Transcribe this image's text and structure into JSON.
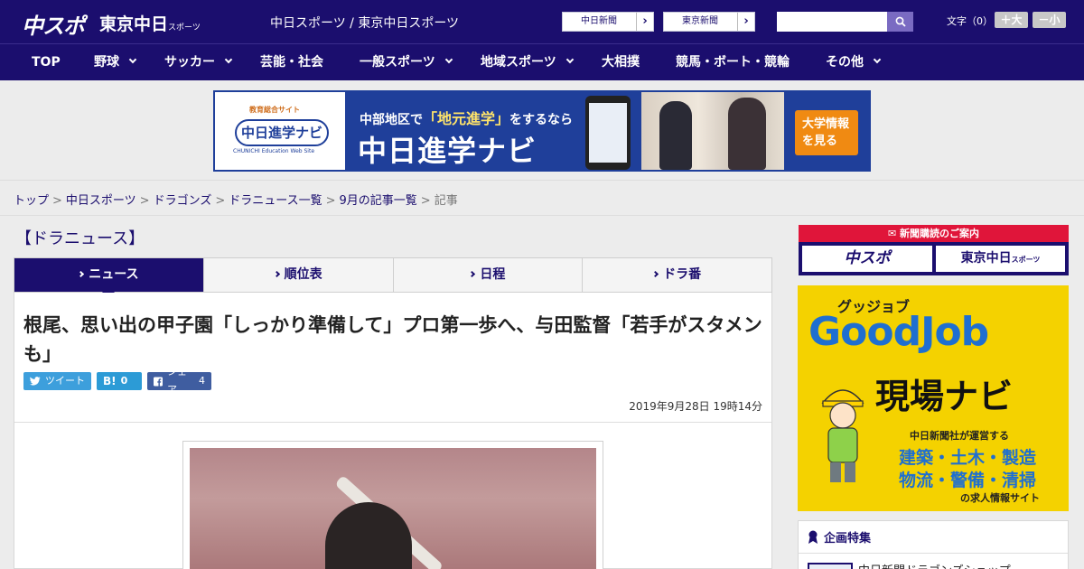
{
  "header": {
    "logo_chuspo": "中スポ",
    "logo_tokyo": "東京中日",
    "logo_tokyo_small": "スポーツ",
    "title": "中日スポーツ / 東京中日スポーツ",
    "site_link_1": "中日新聞",
    "site_link_2": "東京新聞",
    "search_placeholder": "",
    "fontsize_label": "文字（0）",
    "font_bigger": "＋大",
    "font_smaller": "－小",
    "accent_color": "#1b0e6e"
  },
  "nav": {
    "items": [
      {
        "label": "TOP"
      },
      {
        "label": "野球"
      },
      {
        "label": "サッカー"
      },
      {
        "label": "芸能・社会"
      },
      {
        "label": "一般スポーツ"
      },
      {
        "label": "地域スポーツ"
      },
      {
        "label": "大相撲"
      },
      {
        "label": "競馬・ボート・競輪"
      },
      {
        "label": "その他"
      }
    ]
  },
  "banner": {
    "logo_caption": "教育総合サイト",
    "logo_name": "中日進学ナビ",
    "logo_sub": "CHUNICHI Education Web Site",
    "sub_pre": "中部地区で",
    "sub_hl": "「地元進学」",
    "sub_post": "をするなら",
    "main": "中日進学ナビ",
    "cta_line1": "大学情報",
    "cta_line2": "を見る"
  },
  "breadcrumb": {
    "items": [
      "トップ",
      "中日スポーツ",
      "ドラゴンズ",
      "ドラニュース一覧",
      "9月の記事一覧"
    ],
    "current": "記事"
  },
  "section_title": "【ドラニュース】",
  "tabs": [
    {
      "label": "ニュース",
      "active": true
    },
    {
      "label": "順位表",
      "active": false
    },
    {
      "label": "日程",
      "active": false
    },
    {
      "label": "ドラ番",
      "active": false
    }
  ],
  "article": {
    "title": "根尾、思い出の甲子園「しっかり準備して」プロ第一歩へ、与田監督「若手がスタメンも」",
    "share": {
      "tweet": "ツイート",
      "hatena_count": "0",
      "facebook": "シェア",
      "facebook_count": "4"
    },
    "date": "2019年9月28日 19時14分"
  },
  "sidebar": {
    "subscribe_head": "新聞購読のご案内",
    "subscribe_logo_1": "中スポ",
    "subscribe_logo_2": "東京中日",
    "subscribe_logo_2_small": "スポーツ",
    "ad": {
      "kana": "グッジョブ",
      "big": "GoodJob",
      "navi": "現場ナビ",
      "desc": "中日新聞社が運営する",
      "cat_1": "建築・土木・製造",
      "cat_2": "物流・警備・清掃",
      "tail": "の求人情報サイト"
    },
    "kikaku_title": "企画特集",
    "kikaku_item": "中日新聞ドラゴンズショップ"
  }
}
